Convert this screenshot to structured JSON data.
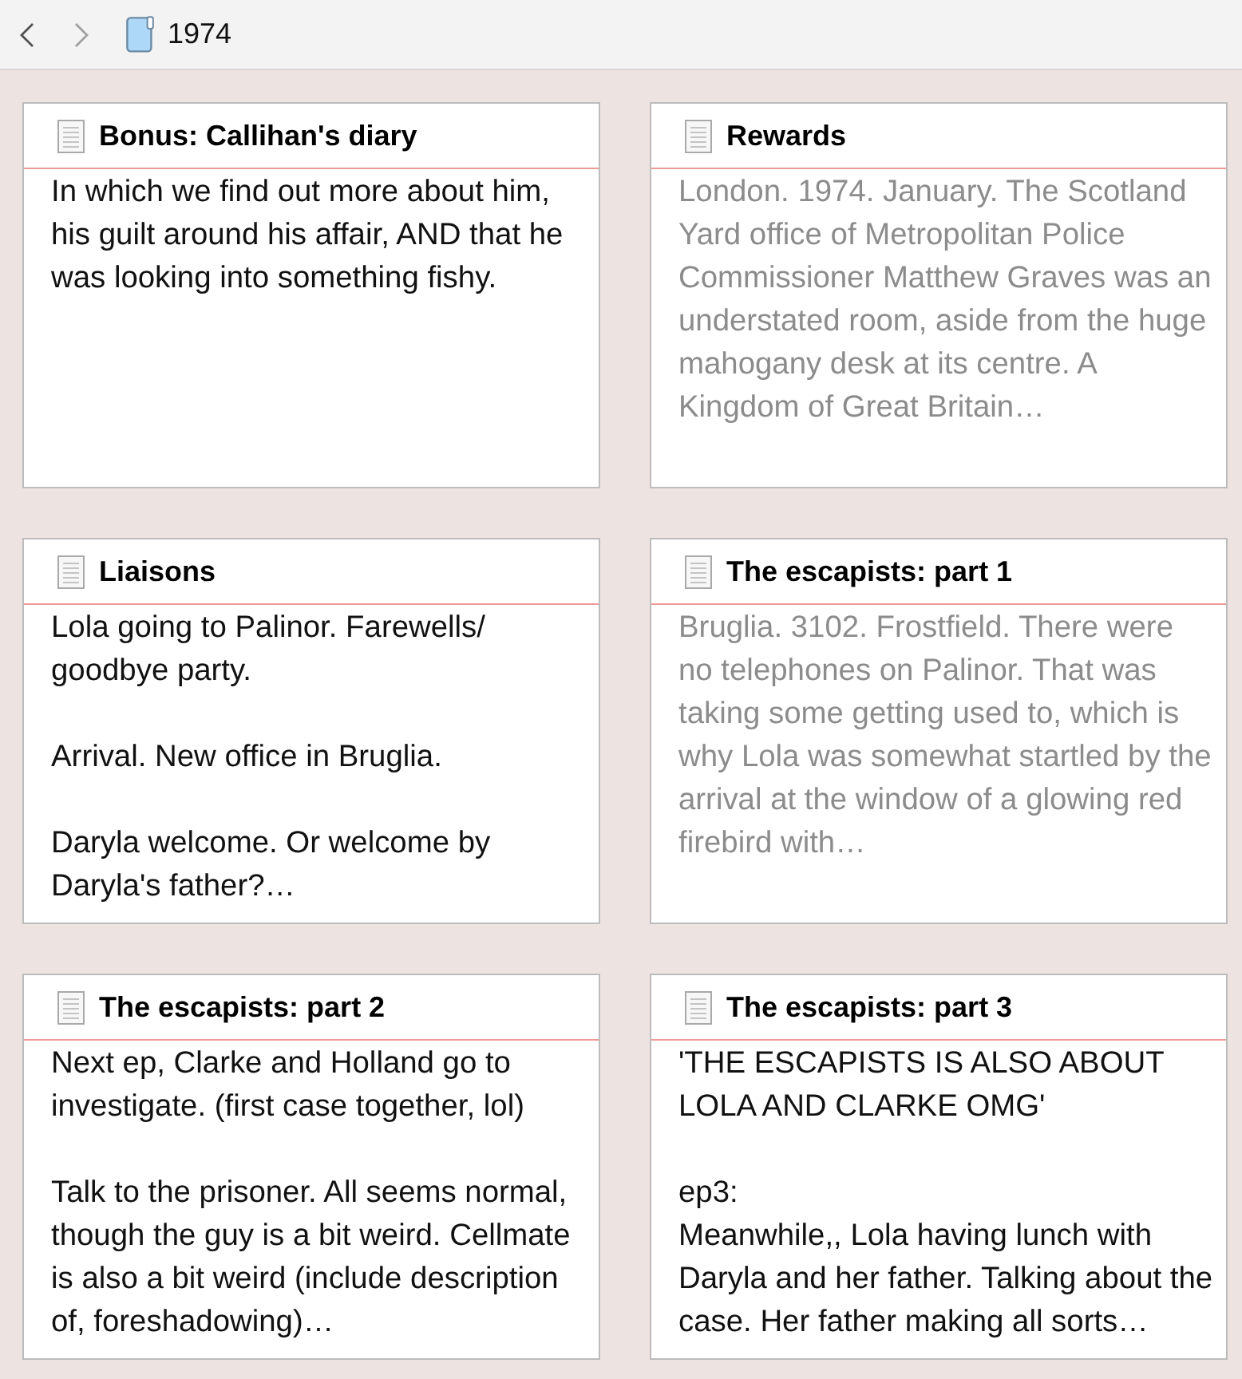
{
  "nav": {
    "back": {
      "disabled": false
    },
    "forward": {
      "disabled": true
    },
    "title": "1974"
  },
  "cards": [
    {
      "title": "Bonus: Callihan's diary",
      "kind": "synopsis",
      "text": "In which we find out more about him, his guilt around his affair, AND that he was looking into something fishy."
    },
    {
      "title": "Rewards",
      "kind": "excerpt",
      "text": "London. 1974. January. The Scotland Yard office of Metropolitan Police Commissioner Matthew Graves was an understated room, aside from the huge mahogany desk at its centre. A Kingdom of Great Britain…"
    },
    {
      "title": "Liaisons",
      "kind": "synopsis",
      "text": "Lola going to Palinor. Farewells/ goodbye party.\n\nArrival. New office in Bruglia.\n\nDaryla welcome. Or welcome by Daryla's father?…"
    },
    {
      "title": "The escapists: part 1",
      "kind": "excerpt",
      "text": "Bruglia. 3102. Frostfield. There were no telephones on Palinor. That was taking some getting used to, which is why Lola was somewhat startled by the arrival at the window of a glowing red firebird with…"
    },
    {
      "title": "The escapists: part 2",
      "kind": "synopsis",
      "text": "Next ep, Clarke and Holland go to investigate. (first case together, lol)\n\nTalk to the prisoner. All seems normal, though the guy is a bit weird. Cellmate is also a bit weird (include description of, foreshadowing)…"
    },
    {
      "title": "The escapists: part 3",
      "kind": "synopsis",
      "text": "'THE ESCAPISTS IS ALSO ABOUT LOLA AND CLARKE OMG'\n\nep3:\nMeanwhile,, Lola having lunch with Daryla and her father. Talking about the case. Her father making all sorts…"
    }
  ]
}
